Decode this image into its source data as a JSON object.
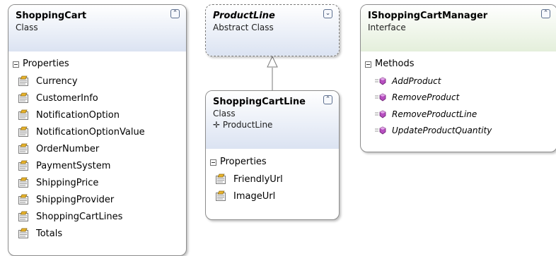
{
  "shopping_cart": {
    "name": "ShoppingCart",
    "stereotype": "Class",
    "section_label": "Properties",
    "properties": [
      "Currency",
      "CustomerInfo",
      "NotificationOption",
      "NotificationOptionValue",
      "OrderNumber",
      "PaymentSystem",
      "ShippingPrice",
      "ShippingProvider",
      "ShoppingCartLines",
      "Totals"
    ],
    "collapse_glyph": "⌃",
    "property_icon": "property-icon"
  },
  "product_line": {
    "name": "ProductLine",
    "stereotype": "Abstract Class",
    "expand_glyph": "⌄"
  },
  "shopping_cart_line": {
    "name": "ShoppingCartLine",
    "stereotype": "Class",
    "inherits": "✛ ProductLine",
    "section_label": "Properties",
    "properties": [
      "FriendlyUrl",
      "ImageUrl"
    ],
    "collapse_glyph": "⌃"
  },
  "manager": {
    "name": "IShoppingCartManager",
    "stereotype": "Interface",
    "section_label": "Methods",
    "methods": [
      "AddProduct",
      "RemoveProduct",
      "RemoveProductLine",
      "UpdateProductQuantity"
    ],
    "collapse_glyph": "⌃",
    "method_icon": "method-icon"
  },
  "colors": {
    "class_header": "#dbe3f2",
    "interface_header": "#e4efdb",
    "border": "#8d8d8d"
  }
}
